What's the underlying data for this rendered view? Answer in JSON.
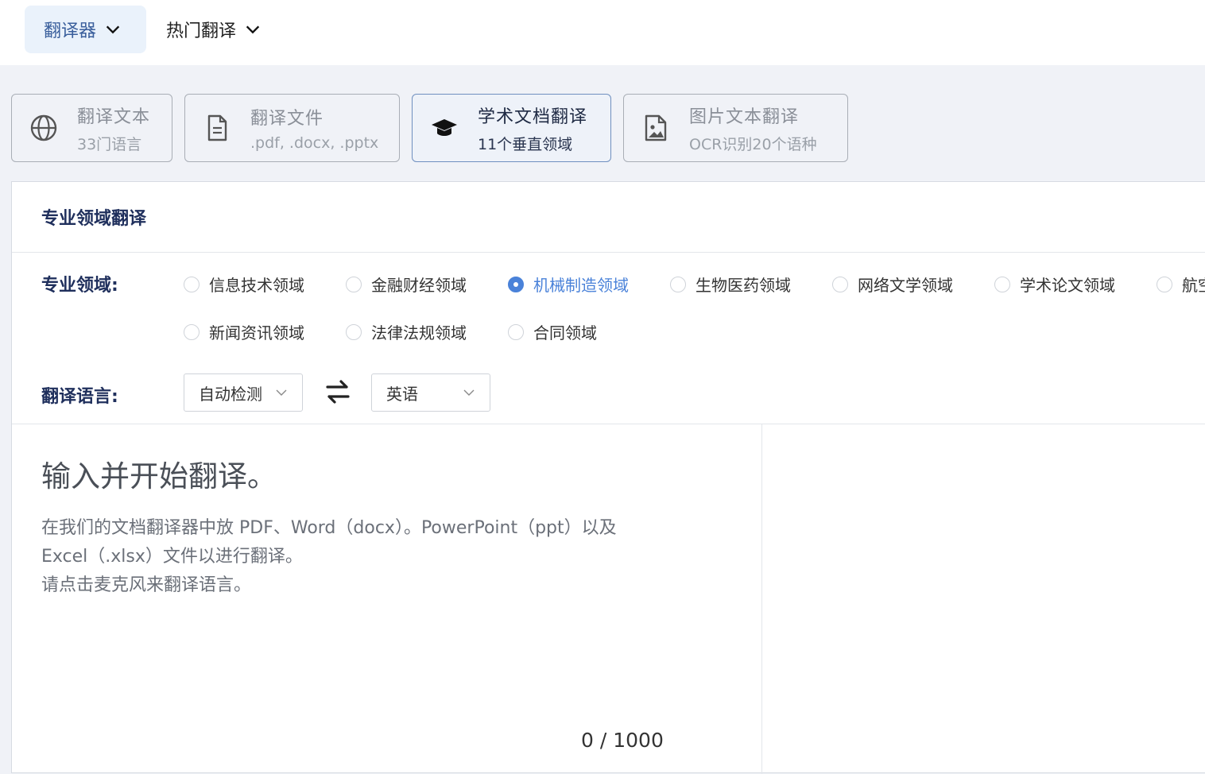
{
  "topnav": {
    "translator_label": "翻译器",
    "hot_label": "热门翻译"
  },
  "tabs": [
    {
      "title": "翻译文本",
      "subtitle": "33门语言",
      "icon": "globe-icon",
      "selected": false
    },
    {
      "title": "翻译文件",
      "subtitle": ".pdf, .docx, .pptx",
      "icon": "document-icon",
      "selected": false
    },
    {
      "title": "学术文档翻译",
      "subtitle": "11个垂直领域",
      "icon": "graduation-cap-icon",
      "selected": true
    },
    {
      "title": "图片文本翻译",
      "subtitle": "OCR识别20个语种",
      "icon": "image-file-icon",
      "selected": false
    }
  ],
  "panel": {
    "title": "专业领域翻译",
    "domain_label": "专业领域:",
    "domains": [
      {
        "label": "信息技术领域",
        "checked": false
      },
      {
        "label": "金融财经领域",
        "checked": false
      },
      {
        "label": "机械制造领域",
        "checked": true
      },
      {
        "label": "生物医药领域",
        "checked": false
      },
      {
        "label": "网络文学领域",
        "checked": false
      },
      {
        "label": "学术论文领域",
        "checked": false
      },
      {
        "label": "航空",
        "checked": false
      },
      {
        "label": "新闻资讯领域",
        "checked": false
      },
      {
        "label": "法律法规领域",
        "checked": false
      },
      {
        "label": "合同领域",
        "checked": false
      }
    ],
    "language_label": "翻译语言:",
    "source_lang": "自动检测",
    "target_lang": "英语",
    "input_placeholder": "输入并开始翻译。",
    "hint_line1": "在我们的文档翻译器中放 PDF、Word（docx）。PowerPoint（ppt）以及",
    "hint_line2": "Excel（.xlsx）文件以进行翻译。",
    "hint_line3": "请点击麦克风来翻译语言。",
    "counter": "0 / 1000"
  },
  "colors": {
    "accent": "#4a82d9",
    "title_navy": "#1f2f5c",
    "nav_active_bg": "#eaf2fb"
  }
}
